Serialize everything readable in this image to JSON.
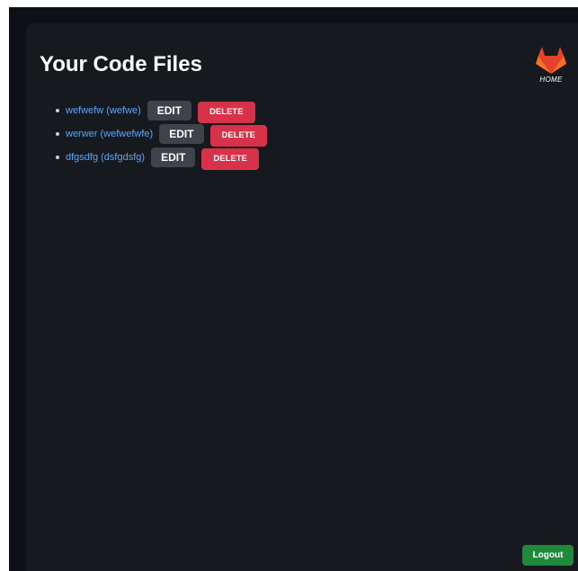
{
  "page": {
    "title": "Your Code Files"
  },
  "home": {
    "label": "HOME",
    "icon": "gitlab-fox-icon"
  },
  "files": [
    {
      "link": "wefwefw (wefwe)",
      "edit_label": "EDIT",
      "delete_label": "DELETE"
    },
    {
      "link": "werwer (wefwefwfe)",
      "edit_label": "EDIT",
      "delete_label": "DELETE"
    },
    {
      "link": "dfgsdfg (dsfgdsfg)",
      "edit_label": "EDIT",
      "delete_label": "DELETE"
    }
  ],
  "footer": {
    "logout_label": "Logout"
  },
  "colors": {
    "background": "#0d1117",
    "panel": "#161a1e",
    "link": "#58a6ff",
    "edit_button": "#3f444c",
    "delete_button": "#d7324a",
    "logout_button": "#1f8a3a"
  }
}
